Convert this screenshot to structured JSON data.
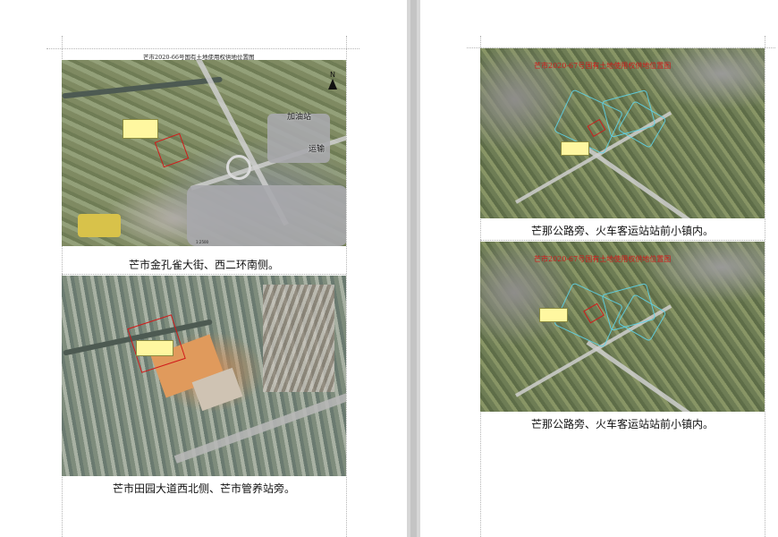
{
  "left_page": {
    "header_title": "芒市2020-66号国有土地使用权供地位置图",
    "map1": {
      "north_label": "N",
      "place_labels": [
        "加油站",
        "运输"
      ],
      "scale_label": "1:2500"
    },
    "caption1": "芒市金孔雀大街、西二环南侧。",
    "caption2": "芒市田园大道西北侧、芒市管养站旁。"
  },
  "right_page": {
    "map_title": "芒市2020-67号国有土地使用权供地位置图",
    "caption1": "芒那公路旁、火车客运站站前小镇内。",
    "caption2": "芒那公路旁、火车客运站站前小镇内。"
  },
  "colors": {
    "parcel_outline": "#d11a1a",
    "planning_lines": "#5ed3e8",
    "page_bg": "#ffffff",
    "workspace_bg": "#e6e6e6"
  }
}
